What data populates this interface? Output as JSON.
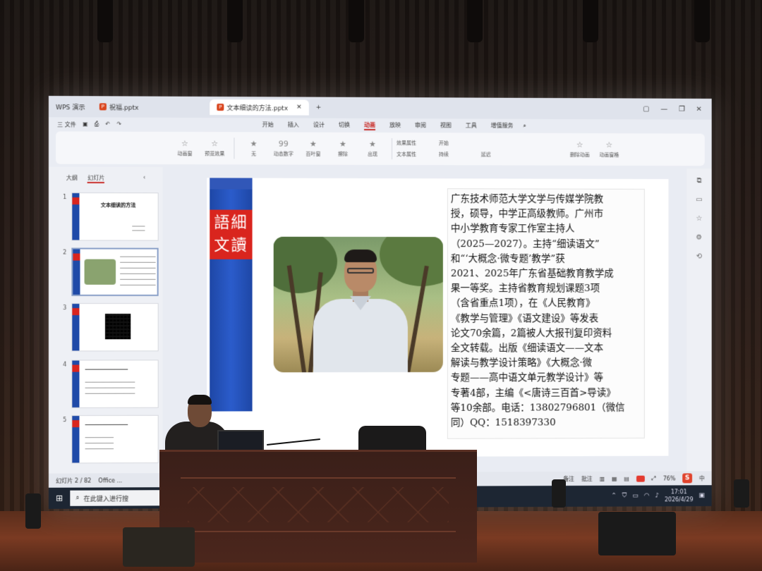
{
  "window": {
    "app_tab": "WPS 演示",
    "tabs": [
      {
        "label": "祝福.pptx",
        "active": false
      },
      {
        "label": "文本细读的方法.pptx",
        "active": true
      }
    ],
    "new_tab": "+"
  },
  "qat": {
    "file_menu": "三 文件"
  },
  "menus": [
    "开始",
    "插入",
    "设计",
    "切换",
    "动画",
    "放映",
    "审阅",
    "视图",
    "工具",
    "增值服务"
  ],
  "active_menu": "动画",
  "ribbon": {
    "group1": [
      "动画窗",
      "预览效果"
    ],
    "effects": [
      "无",
      "动态数字",
      "百叶窗",
      "擦除",
      "出现"
    ],
    "props": [
      "效果属性",
      "文本属性"
    ],
    "timing": [
      "开始",
      "持续",
      "延迟"
    ],
    "right": [
      "删除动画",
      "动画窗格"
    ]
  },
  "sidebar": {
    "tabs": [
      "大纲",
      "幻灯片"
    ],
    "active_tab": "幻灯片",
    "thumbs": [
      {
        "num": "1",
        "title": "文本细读的方法"
      },
      {
        "num": "2",
        "title": ""
      },
      {
        "num": "3",
        "title": ""
      },
      {
        "num": "4",
        "title": ""
      },
      {
        "num": "5",
        "title": ""
      }
    ]
  },
  "slide": {
    "seal_line1": "語細",
    "seal_line2": "文讀",
    "bio_lines": [
      "广东技术师范大学文学与传媒学院教",
      "授，硕导，中学正高级教师。广州市",
      "中小学教育专家工作室主持人",
      "（2025—2027）。主持“细读语文”",
      "和“‘大概念·微专题’教学”获",
      "2021、2025年广东省基础教育教学成",
      "果一等奖。主持省教育规划课题3项",
      "（含省重点1项），在《人民教育》",
      "《教学与管理》《语文建设》等发表",
      "论文70余篇，2篇被人大报刊复印资料",
      "全文转载。出版《细读语文——文本",
      "解读与教学设计策略》《大概念·微",
      "专题——高中语文单元教学设计》等",
      "专著4部，主编《<唐诗三百首>导读》",
      "等10余部。电话：13802796801（微信",
      "同）QQ：1518397330"
    ]
  },
  "status": {
    "slide_counter": "幻灯片 2 / 82",
    "office": "Office ...",
    "note_btn": "备注",
    "comment_btn": "批注",
    "zoom": "76%"
  },
  "taskbar": {
    "search_placeholder": "在此键入进行搜",
    "time": "17:01",
    "date": "2026/4/29",
    "ime_label": "S",
    "ime_lang": "中"
  },
  "colors": {
    "accent": "#c9302c",
    "slide_blue": "#1e47a6",
    "seal_red": "#d9251e"
  }
}
